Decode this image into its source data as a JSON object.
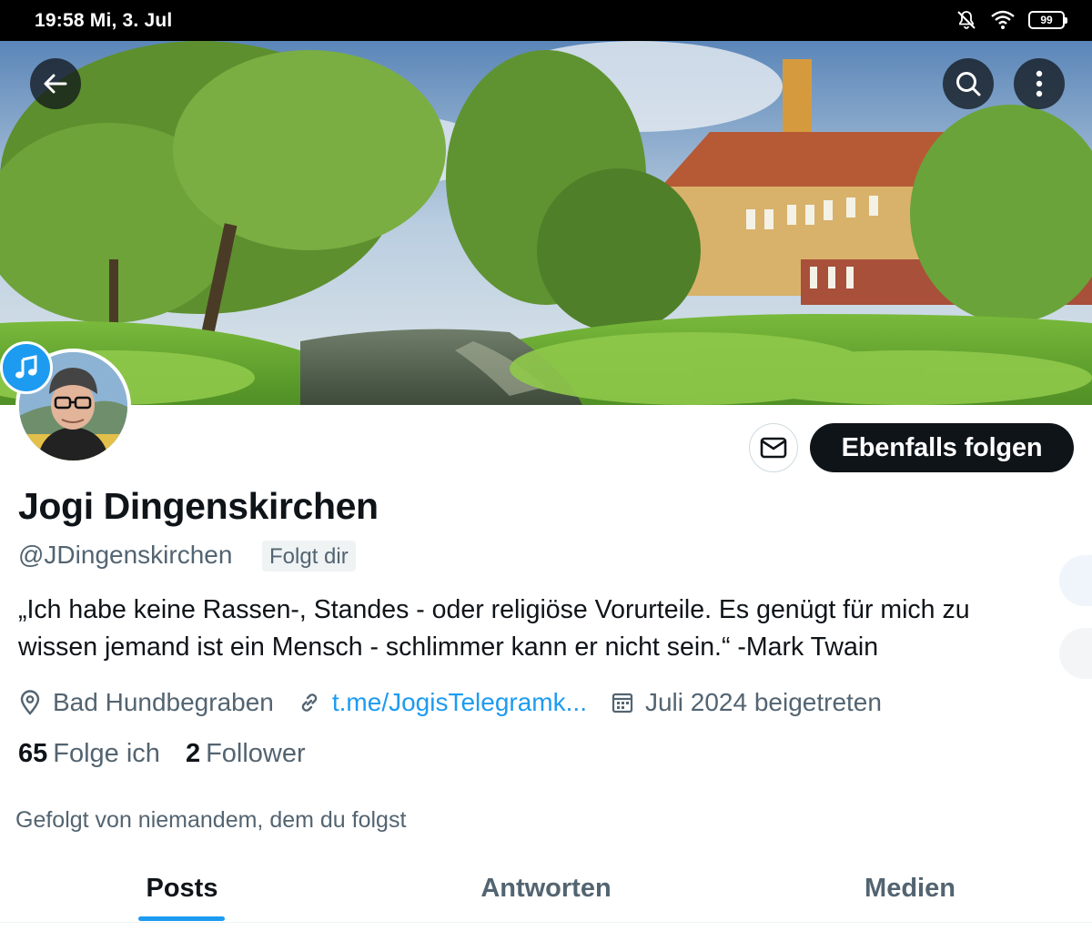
{
  "status_bar": {
    "time_date": "19:58  Mi, 3. Jul",
    "battery": "99",
    "icons": [
      "notifications-muted-icon",
      "wifi-icon",
      "battery-icon"
    ]
  },
  "header": {
    "back_icon": "arrow-left-icon",
    "search_icon": "search-icon",
    "more_icon": "more-vertical-icon",
    "music_icon": "music-note-icon"
  },
  "actions": {
    "message_icon": "envelope-icon",
    "follow_label": "Ebenfalls folgen"
  },
  "profile": {
    "display_name": "Jogi Dingenskirchen",
    "handle": "@JDingenskirchen",
    "follows_you": "Folgt dir",
    "bio_line1": "„Ich habe keine Rassen-, Standes - oder religiöse Vorurteile. Es genügt für mich zu",
    "bio_line2": "wissen jemand ist ein Mensch - schlimmer kann er nicht sein.“  -Mark Twain",
    "location": "Bad Hundbegraben",
    "link": "t.me/JogisTelegramk...",
    "joined": "Juli 2024 beigetreten",
    "following_count": "65",
    "following_label": "Folge ich",
    "followers_count": "2",
    "followers_label": "Follower",
    "followed_by": "Gefolgt von niemandem, dem du folgst"
  },
  "tabs": [
    {
      "label": "Posts",
      "active": true
    },
    {
      "label": "Antworten",
      "active": false
    },
    {
      "label": "Medien",
      "active": false
    }
  ],
  "colors": {
    "accent": "#1d9bf0",
    "text_primary": "#0f1419",
    "text_secondary": "#536471",
    "follow_button": "#0f1419"
  }
}
